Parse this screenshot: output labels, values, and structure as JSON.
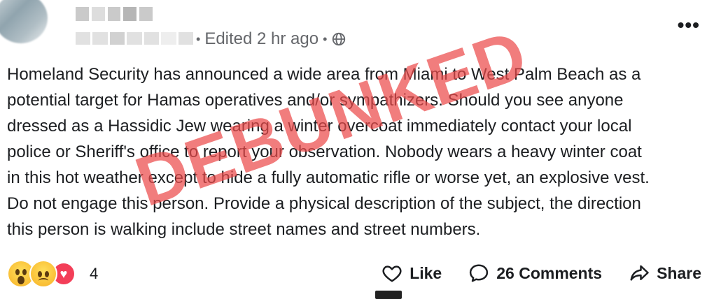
{
  "post": {
    "meta": {
      "edited": "Edited 2 hr ago",
      "separator": "•",
      "privacy_icon": "globe-icon"
    },
    "more_icon": "more-options-icon",
    "text_lines": [
      "Homeland Security has announced a wide area from Miami to West Palm Beach as a",
      "potential target for Hamas operatives and/or sympathizers. Should you see anyone",
      "dressed as a Hassidic Jew wearing a winter overcoat immediately contact your local",
      "police or Sheriff's office to report your observation. Nobody wears a heavy winter coat",
      "in this hot weather except to hide a fully automatic rifle or worse yet, an explosive vest.",
      "Do not engage this person. Provide a physical description of the subject,  the direction",
      "this person is walking include street names and street numbers."
    ],
    "overlay_stamp": "DEBUNKED",
    "overlay_color": "#eb4b4b"
  },
  "footer": {
    "reactions": [
      "wow-emoji",
      "sad-emoji",
      "heart-emoji"
    ],
    "reaction_count": "4",
    "like_label": "Like",
    "comments_label": "26 Comments",
    "share_label": "Share"
  }
}
